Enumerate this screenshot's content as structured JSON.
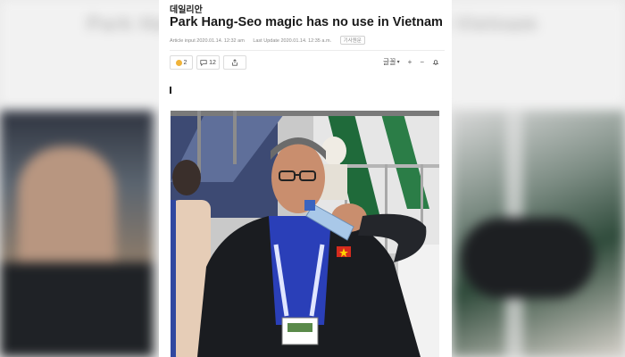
{
  "backdrop": {
    "blurred_title": "Park Hang-Seo magic has no use in Vietnam"
  },
  "article": {
    "source": "데일리안",
    "headline": "Park Hang-Seo magic has no use in Vietnam",
    "meta": {
      "input": "Article input 2020.01.14. 12:32 am",
      "update": "Last Update 2020.01.14. 12:35 a.m.",
      "badge": "기사원문"
    },
    "actions": {
      "reaction_count": "2",
      "comment_count": "12",
      "font_label": "글꼴"
    },
    "photo": {
      "alt": "Park Hang-Seo drinking water"
    }
  },
  "colors": {
    "headline": "#1b1b1b",
    "shirt_blue": "#2a3fb8",
    "jacket": "#1a1c20",
    "stadium_green": "#1f6a3a"
  }
}
